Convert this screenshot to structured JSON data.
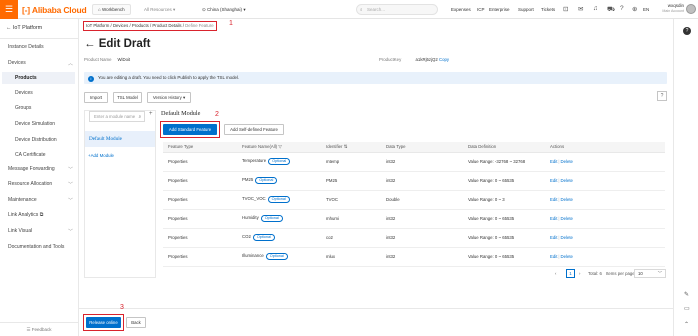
{
  "topbar": {
    "logo_mark": "[-]",
    "logo_text": "Alibaba Cloud",
    "workbench": "Workbench",
    "all_resources": "All Resources",
    "region": "China (Shanghai)",
    "search_placeholder": "Search...",
    "nav": [
      "Expenses",
      "ICP",
      "Enterprise",
      "Support",
      "Tickets"
    ],
    "language": "EN",
    "username": "wxqsdin",
    "user_sub": "Main Account"
  },
  "sidebar": {
    "back_label": "IoT Platform",
    "items": [
      {
        "label": "Instance Details"
      },
      {
        "label": "Devices"
      },
      {
        "label": "Products"
      },
      {
        "label": "Devices"
      },
      {
        "label": "Groups"
      },
      {
        "label": "Device Simulation"
      },
      {
        "label": "Device Distribution"
      },
      {
        "label": "CA Certificate"
      },
      {
        "label": "Message Forwarding"
      },
      {
        "label": "Resource Allocation"
      },
      {
        "label": "Maintenance"
      },
      {
        "label": "Link Analytics"
      },
      {
        "label": "Link Visual"
      },
      {
        "label": "Documentation and Tools"
      }
    ],
    "feedback": "Feedback"
  },
  "breadcrumb": {
    "items": [
      "IoT Platform",
      "Devices",
      "Products",
      "Product Details"
    ],
    "current": "Define Feature",
    "separator": "/"
  },
  "annotations": {
    "a1": "1",
    "a2": "2",
    "a3": "3"
  },
  "page": {
    "title": "Edit Draft",
    "product_name_label": "Product Name",
    "product_name": "WiDoit",
    "product_key_label": "ProductKey",
    "product_key": "a1kRj5zjQ2",
    "copy_label": "Copy"
  },
  "notice": {
    "text": "You are editing a draft. You need to click Publish to apply the TSL model."
  },
  "toolbar": {
    "import": "Import",
    "tsl_model": "TSL Model",
    "version_history": "Version History",
    "help": "?"
  },
  "modules": {
    "search_placeholder": "Enter a module name",
    "plus": "+",
    "default_module": "Default Module",
    "add_modules": "+Add Module"
  },
  "feature_panel": {
    "title": "Default Module",
    "add_standard": "Add Standard Feature",
    "add_self": "Add Self-defined Feature",
    "columns": [
      "Feature Type",
      "Feature Name(All)",
      "Identifier",
      "Data Type",
      "Data Definition",
      "Actions"
    ],
    "optional_label": "Optional",
    "edit_label": "Edit",
    "delete_label": "Delete",
    "rows": [
      {
        "type": "Properties",
        "name": "Temperature",
        "identifier": "mtemp",
        "data_type": "int32",
        "definition": "Value Range: -32768 ~ 32768"
      },
      {
        "type": "Properties",
        "name": "PM25",
        "identifier": "PM25",
        "data_type": "int32",
        "definition": "Value Range: 0 ~ 65535"
      },
      {
        "type": "Properties",
        "name": "TVOC_VOC",
        "identifier": "TVOC",
        "data_type": "Double",
        "definition": "Value Range: 0 ~ 3"
      },
      {
        "type": "Properties",
        "name": "Humidity",
        "identifier": "mhumi",
        "data_type": "int32",
        "definition": "Value Range: 0 ~ 65535"
      },
      {
        "type": "Properties",
        "name": "CO2",
        "identifier": "co2",
        "data_type": "int32",
        "definition": "Value Range: 0 ~ 65535"
      },
      {
        "type": "Properties",
        "name": "Illuminance",
        "identifier": "mlux",
        "data_type": "int32",
        "definition": "Value Range: 0 ~ 65535"
      }
    ]
  },
  "pagination": {
    "page": "1",
    "total": "Total: 6",
    "per_page_label": "Items per page",
    "per_page": "10"
  },
  "footer": {
    "release": "Release online",
    "back": "Back"
  }
}
